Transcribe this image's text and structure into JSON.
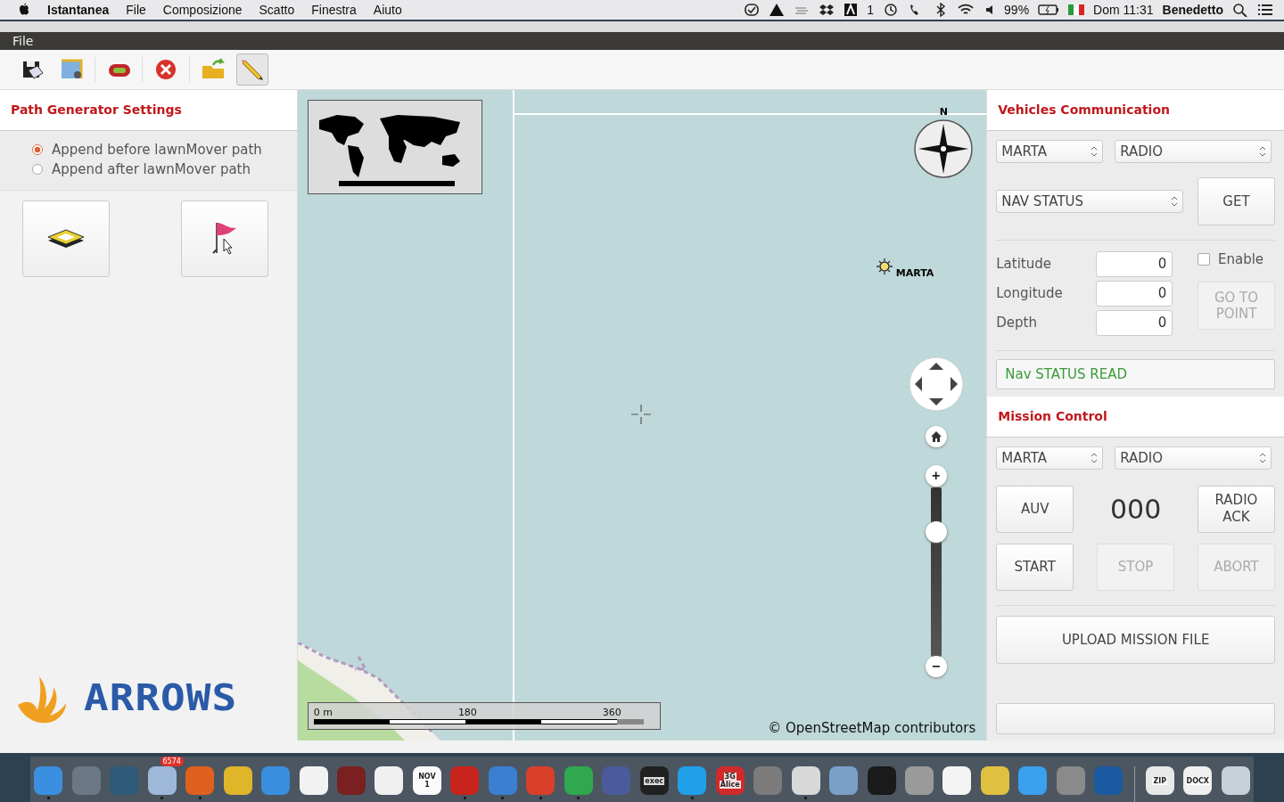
{
  "menu_bar": {
    "app_name": "Istantanea",
    "menus": [
      "File",
      "Composizione",
      "Scatto",
      "Finestra",
      "Aiuto"
    ],
    "notification_count": "1",
    "battery": "99%",
    "clock": "Dom 11:31",
    "user": "Benedetto"
  },
  "app_menu": [
    "File"
  ],
  "toolbar": [
    {
      "kind": "save",
      "selected": false
    },
    {
      "kind": "map",
      "selected": false
    },
    {
      "kind": "track",
      "selected": false
    },
    {
      "kind": "delete",
      "selected": false
    },
    {
      "kind": "folder",
      "selected": false
    },
    {
      "kind": "pencil",
      "selected": true
    }
  ],
  "path_generator": {
    "title": "Path Generator Settings",
    "options": [
      {
        "label": "Append before lawnMover path",
        "selected": true
      },
      {
        "label": "Append after lawnMover path",
        "selected": false
      }
    ],
    "tools": [
      {
        "kind": "layers"
      },
      {
        "kind": "flag"
      }
    ],
    "logo": "ARROWS"
  },
  "map": {
    "compass_label": "N",
    "vehicle": "MARTA",
    "zoom": {
      "level": 0.77,
      "in_label": "+",
      "out_label": "−"
    },
    "scale_labels": [
      "0 m",
      "180",
      "360"
    ],
    "attribution": "© OpenStreetMap contributors"
  },
  "vehicles_communication": {
    "title": "Vehicles Communication",
    "vehicle": "MARTA",
    "channel": "RADIO",
    "command": "NAV STATUS",
    "get_button": {
      "label": "GET",
      "disabled": false
    },
    "fields": [
      {
        "label": "Latitude",
        "value": "0"
      },
      {
        "label": "Longitude",
        "value": "0"
      },
      {
        "label": "Depth",
        "value": "0"
      }
    ],
    "enable": {
      "label": "Enable",
      "checked": false
    },
    "goto_button": {
      "label": "GO TO POINT",
      "disabled": true
    },
    "status": "Nav STATUS READ"
  },
  "mission_control": {
    "title": "Mission Control",
    "vehicle": "MARTA",
    "channel": "RADIO",
    "auv_button": {
      "label": "AUV",
      "disabled": false
    },
    "counter": "000",
    "ack_button": {
      "label": "RADIO ACK",
      "disabled": false
    },
    "buttons": [
      {
        "label": "START",
        "disabled": false
      },
      {
        "label": "STOP",
        "disabled": true
      },
      {
        "label": "ABORT",
        "disabled": true
      }
    ],
    "upload_button": {
      "label": "UPLOAD MISSION FILE",
      "disabled": false
    }
  },
  "dock": [
    {
      "color": "#3b8fe0",
      "running": true
    },
    {
      "color": "#6b7785",
      "running": false
    },
    {
      "color": "#2e5b7a",
      "running": false
    },
    {
      "color": "#9db8d8",
      "running": true,
      "badge": "6574"
    },
    {
      "color": "#e0601e",
      "running": true
    },
    {
      "color": "#dfb52a",
      "running": false
    },
    {
      "color": "#3a8ee0",
      "running": false
    },
    {
      "color": "#f2f2f2",
      "running": false
    },
    {
      "color": "#7a2020",
      "running": false
    },
    {
      "color": "#f0f0f0",
      "running": false
    },
    {
      "color": "#fafafa",
      "running": false,
      "texts": [
        "NOV",
        "1"
      ]
    },
    {
      "color": "#c8231c",
      "running": true
    },
    {
      "color": "#3a7fd0",
      "running": true
    },
    {
      "color": "#d8402a",
      "running": true
    },
    {
      "color": "#2fa84f",
      "running": true
    },
    {
      "color": "#4a5a9a",
      "running": false
    },
    {
      "color": "#202020",
      "running": false,
      "texts": [
        "exec"
      ]
    },
    {
      "color": "#1fa0e8",
      "running": true
    },
    {
      "color": "#d02a2a",
      "running": false,
      "texts": [
        "3G",
        "Alice"
      ]
    },
    {
      "color": "#7b7b7b",
      "running": false
    },
    {
      "color": "#d8d8d8",
      "running": true
    },
    {
      "color": "#7aa0c8",
      "running": false
    },
    {
      "color": "#1a1a1a",
      "running": false
    },
    {
      "color": "#9a9a9a",
      "running": false
    },
    {
      "color": "#f4f4f4",
      "running": false
    },
    {
      "color": "#e0c040",
      "running": false
    },
    {
      "color": "#3aa0f0",
      "running": false
    },
    {
      "color": "#8a8a8a",
      "running": false
    },
    {
      "color": "#1a5aa0",
      "running": false
    },
    {
      "color": "#e8e8e8",
      "running": false,
      "separator": true,
      "texts": [
        "ZIP"
      ]
    },
    {
      "color": "#f0f0f0",
      "running": false,
      "texts": [
        "DOCX"
      ]
    },
    {
      "color": "#c8d0d8",
      "running": false
    }
  ]
}
